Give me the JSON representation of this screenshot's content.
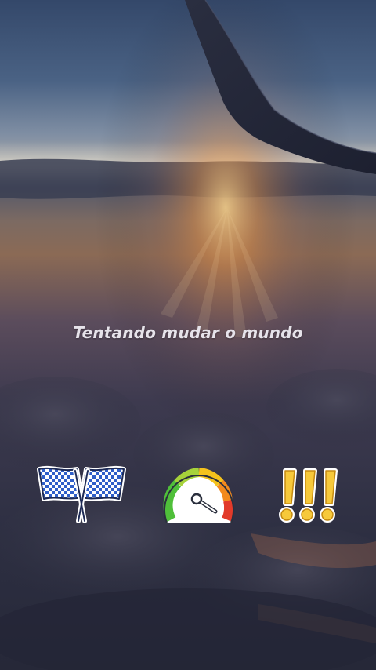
{
  "story": {
    "caption": "Tentando mudar o mundo"
  },
  "stickers": [
    {
      "icon": "checkered-flags-icon"
    },
    {
      "icon": "speedometer-icon"
    },
    {
      "icon": "triple-exclamation-icon"
    }
  ],
  "colors": {
    "sky_top": "#3f5573",
    "sunset_orange": "#c57a3a",
    "clouds_dark": "#2c2d3e",
    "caption_text": "#e6e3ea",
    "flag_blue": "#3a6fd6",
    "exclaim_yellow": "#f7c93b"
  }
}
